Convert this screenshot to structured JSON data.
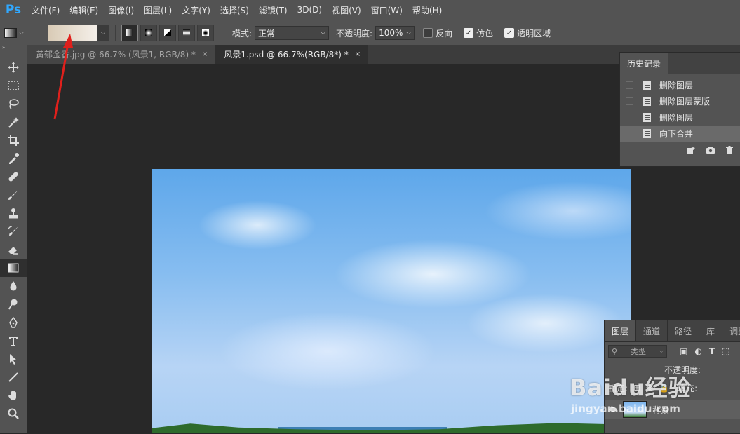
{
  "app": {
    "logo": "Ps"
  },
  "menubar": {
    "items": [
      "文件(F)",
      "编辑(E)",
      "图像(I)",
      "图层(L)",
      "文字(Y)",
      "选择(S)",
      "滤镜(T)",
      "3D(D)",
      "视图(V)",
      "窗口(W)",
      "帮助(H)"
    ]
  },
  "options": {
    "mode_label": "模式:",
    "mode_value": "正常",
    "opacity_label": "不透明度:",
    "opacity_value": "100%",
    "reverse_label": "反向",
    "dither_label": "仿色",
    "transparency_label": "透明区域",
    "gradient_colors": [
      "#d9cbb6",
      "#f5f0ea"
    ]
  },
  "tabs": [
    {
      "label": "黄郁金香.jpg @ 66.7% (风景1, RGB/8) *",
      "close": "×"
    },
    {
      "label": "风景1.psd @ 66.7%(RGB/8*) *",
      "close": "×"
    }
  ],
  "history": {
    "tab": "历史记录",
    "items": [
      "删除图层",
      "删除图层蒙版",
      "删除图层",
      "向下合并"
    ]
  },
  "layers": {
    "tabs": [
      "图层",
      "通道",
      "路径",
      "库",
      "调整"
    ],
    "search_placeholder": "类型",
    "opacity_label": "不透明度:",
    "lock_label": "锁定:",
    "fill_label": "填充:",
    "layer_name": "背景"
  },
  "watermark": {
    "main": "Baidu经验",
    "sub": "jingyan.baidu.com"
  },
  "colors": {
    "accent": "#31a8ff",
    "annotation_arrow": "#e0201c"
  }
}
